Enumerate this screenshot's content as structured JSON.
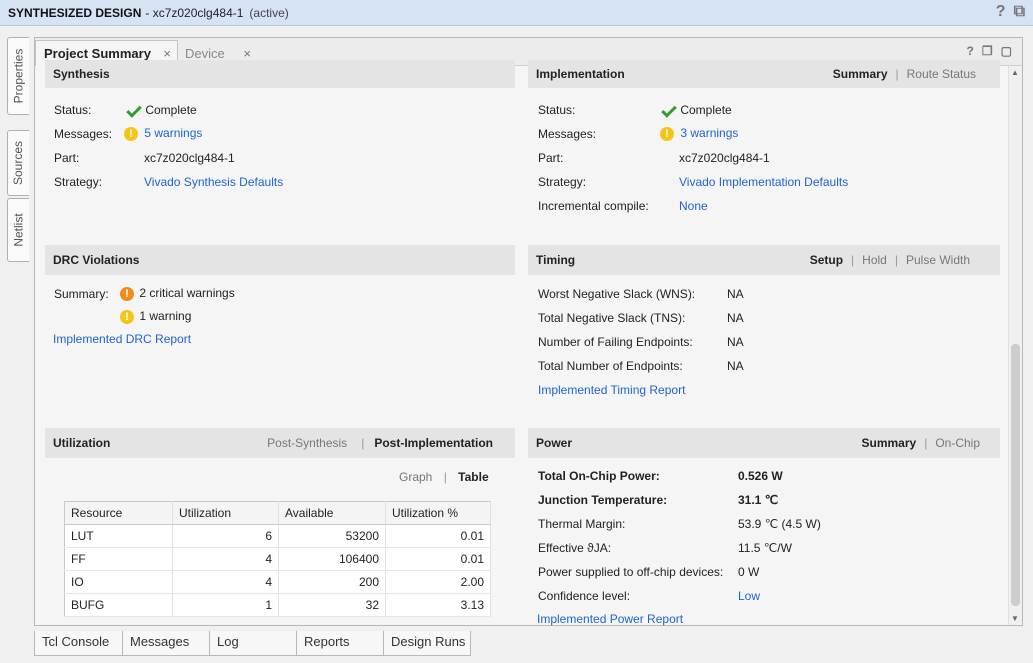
{
  "window": {
    "title": "SYNTHESIZED DESIGN",
    "subtitle": "- xc7z020clg484-1",
    "state": "(active)",
    "help_icon": "?",
    "restore_icon": "⧉"
  },
  "side_tabs": [
    "Properties",
    "Sources",
    "Netlist"
  ],
  "tabs": [
    {
      "label": "Project Summary",
      "close": "×"
    },
    {
      "label": "Device",
      "close": "×"
    }
  ],
  "panel_icons": {
    "help": "?",
    "float": "❐",
    "maximize": "▢"
  },
  "synthesis": {
    "title": "Synthesis",
    "rows": {
      "status_label": "Status:",
      "status_value": "Complete",
      "messages_label": "Messages:",
      "messages_value": "5 warnings",
      "part_label": "Part:",
      "part_value": "xc7z020clg484-1",
      "strategy_label": "Strategy:",
      "strategy_value": "Vivado Synthesis Defaults"
    }
  },
  "implementation": {
    "title": "Implementation",
    "views": {
      "summary": "Summary",
      "sep": "|",
      "route": "Route Status"
    },
    "rows": {
      "status_label": "Status:",
      "status_value": "Complete",
      "messages_label": "Messages:",
      "messages_value": "3 warnings",
      "part_label": "Part:",
      "part_value": "xc7z020clg484-1",
      "strategy_label": "Strategy:",
      "strategy_value": "Vivado Implementation Defaults",
      "incremental_label": "Incremental compile:",
      "incremental_value": "None"
    }
  },
  "drc": {
    "title": "DRC Violations",
    "summary_label": "Summary:",
    "critical": "2 critical warnings",
    "warning": "1 warning",
    "report_link": "Implemented DRC Report"
  },
  "timing": {
    "title": "Timing",
    "views": {
      "setup": "Setup",
      "sep": "|",
      "hold": "Hold",
      "pulse": "Pulse Width"
    },
    "rows": [
      {
        "label": "Worst Negative Slack (WNS):",
        "value": "NA"
      },
      {
        "label": "Total Negative Slack (TNS):",
        "value": "NA"
      },
      {
        "label": "Number of Failing Endpoints:",
        "value": "NA"
      },
      {
        "label": "Total Number of Endpoints:",
        "value": "NA"
      }
    ],
    "report_link": "Implemented Timing Report"
  },
  "utilization": {
    "title": "Utilization",
    "views": {
      "post_synth": "Post-Synthesis",
      "sep": "|",
      "post_impl": "Post-Implementation"
    },
    "modes": {
      "graph": "Graph",
      "sep": "|",
      "table": "Table"
    },
    "headers": [
      "Resource",
      "Utilization",
      "Available",
      "Utilization %"
    ],
    "rows": [
      [
        "LUT",
        "6",
        "53200",
        "0.01"
      ],
      [
        "FF",
        "4",
        "106400",
        "0.01"
      ],
      [
        "IO",
        "4",
        "200",
        "2.00"
      ],
      [
        "BUFG",
        "1",
        "32",
        "3.13"
      ]
    ]
  },
  "power": {
    "title": "Power",
    "views": {
      "summary": "Summary",
      "sep": "|",
      "onchip": "On-Chip"
    },
    "rows": [
      {
        "label": "Total On-Chip Power:",
        "value": "0.526 W"
      },
      {
        "label": "Junction Temperature:",
        "value": "31.1 ℃"
      },
      {
        "label": "Thermal Margin:",
        "value": "53.9 ℃ (4.5 W)"
      },
      {
        "label": "Effective ϑJA:",
        "value": "11.5 ℃/W"
      },
      {
        "label": "Power supplied to off-chip devices:",
        "value": "0 W"
      },
      {
        "label": "Confidence level:",
        "value": "Low"
      }
    ],
    "report_link": "Implemented Power Report"
  },
  "bottom_tabs": [
    "Tcl Console",
    "Messages",
    "Log",
    "Reports",
    "Design Runs"
  ],
  "colors": {
    "link": "#1f63d0",
    "check": "#2f9e2f",
    "warning": "#f5c518",
    "critical": "#f08c1a",
    "titlebar": "#d6e3f4"
  }
}
